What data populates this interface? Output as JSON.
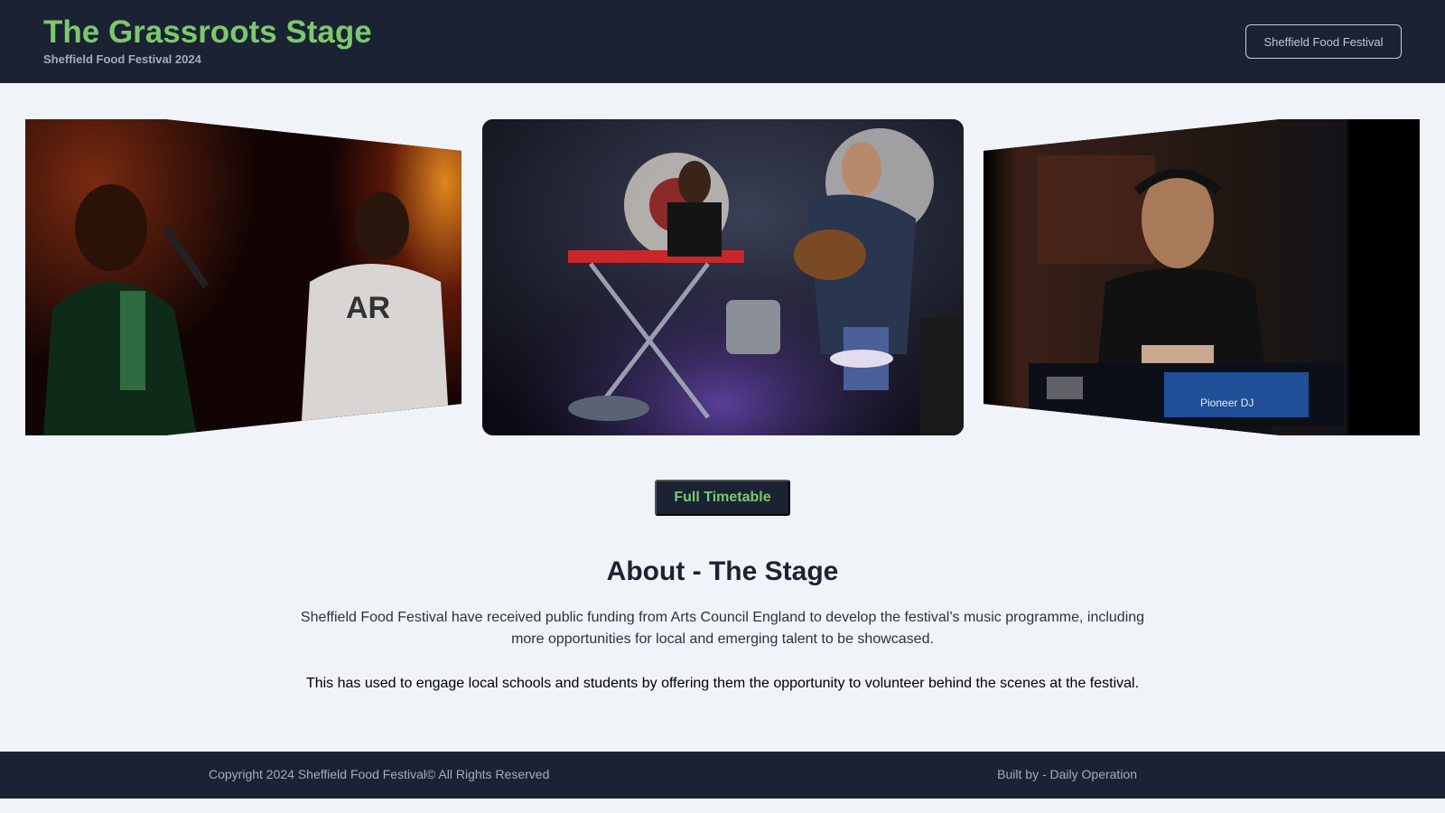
{
  "header": {
    "title": "The Grassroots Stage",
    "subtitle": "Sheffield Food Festival 2024",
    "nav_button_label": "Sheffield Food Festival"
  },
  "carousel": {
    "slides": [
      {
        "description": "singers-on-stage-photo"
      },
      {
        "description": "band-performing-photo"
      },
      {
        "description": "dj-performing-photo"
      }
    ]
  },
  "cta": {
    "label": "Full Timetable"
  },
  "about": {
    "title": "About - The Stage",
    "paragraph1": "Sheffield Food Festival have received public funding from Arts Council England to develop the festival’s music programme, including more opportunities for local and emerging talent to be showcased.",
    "paragraph2": "This has used to engage local schools and students by offering them the opportunity to volunteer behind the scenes at the festival."
  },
  "footer": {
    "copyright": "Copyright 2024 Sheffield Food Festival© All Rights Reserved",
    "built_by": "Built by - Daily Operation"
  },
  "colors": {
    "header_bg": "#1b2234",
    "accent_green": "#7cc96b",
    "page_bg": "#f0f4f9"
  }
}
